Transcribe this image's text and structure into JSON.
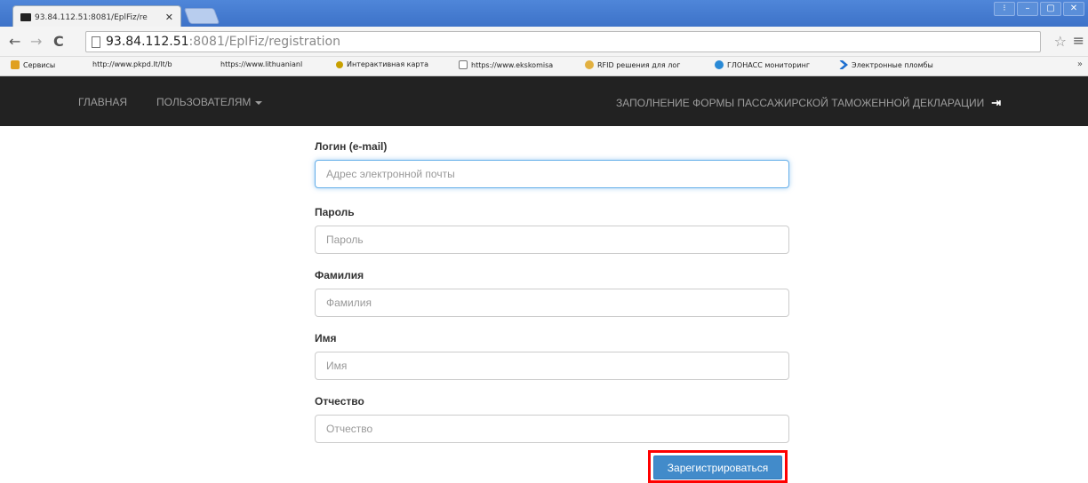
{
  "browser": {
    "tab_title": "93.84.112.51:8081/EplFiz/re",
    "tab_close": "✕",
    "window_controls": [
      "⁝",
      "–",
      "▢",
      "✕"
    ],
    "url_host": "93.84.112.51",
    "url_path": ":8081/EplFiz/registration",
    "back_icon": "←",
    "forward_icon": "→",
    "reload_icon": "C",
    "star_icon": "☆",
    "menu_icon": "≡",
    "bookmarks_more": "»",
    "bookmarks": [
      {
        "label": "Сервисы",
        "icon": "apps-icon",
        "color": "#e0a020"
      },
      {
        "label": "http://www.pkpd.lt/lt/b",
        "icon": "",
        "color": ""
      },
      {
        "label": "https://www.lithuanianl",
        "icon": "",
        "color": ""
      },
      {
        "label": "Интерактивная карта",
        "icon": "map-icon",
        "color": "#c8a000"
      },
      {
        "label": "https://www.ekskomisa",
        "icon": "page-icon",
        "color": "#ffffff"
      },
      {
        "label": "RFID решения для лог",
        "icon": "rfid-icon",
        "color": "#e2b040"
      },
      {
        "label": "ГЛОНАСС мониторинг",
        "icon": "glonass-icon",
        "color": "#2a8ad6"
      },
      {
        "label": "Электронные пломбы",
        "icon": "arrow-icon",
        "color": "#1e6fd0"
      }
    ]
  },
  "navbar": {
    "home": "Главная",
    "users": "Пользователям",
    "declaration": "Заполнение формы пассажирской таможенной декларации",
    "login_icon": "⇥"
  },
  "form": {
    "login_label": "Логин (e-mail)",
    "login_placeholder": "Адрес электронной почты",
    "password_label": "Пароль",
    "password_placeholder": "Пароль",
    "surname_label": "Фамилия",
    "surname_placeholder": "Фамилия",
    "name_label": "Имя",
    "name_placeholder": "Имя",
    "patronymic_label": "Отчество",
    "patronymic_placeholder": "Отчество",
    "submit_label": "Зарегистрироваться"
  },
  "colors": {
    "navbar_bg": "#222222",
    "primary": "#428bca",
    "highlight": "#ff0000"
  }
}
